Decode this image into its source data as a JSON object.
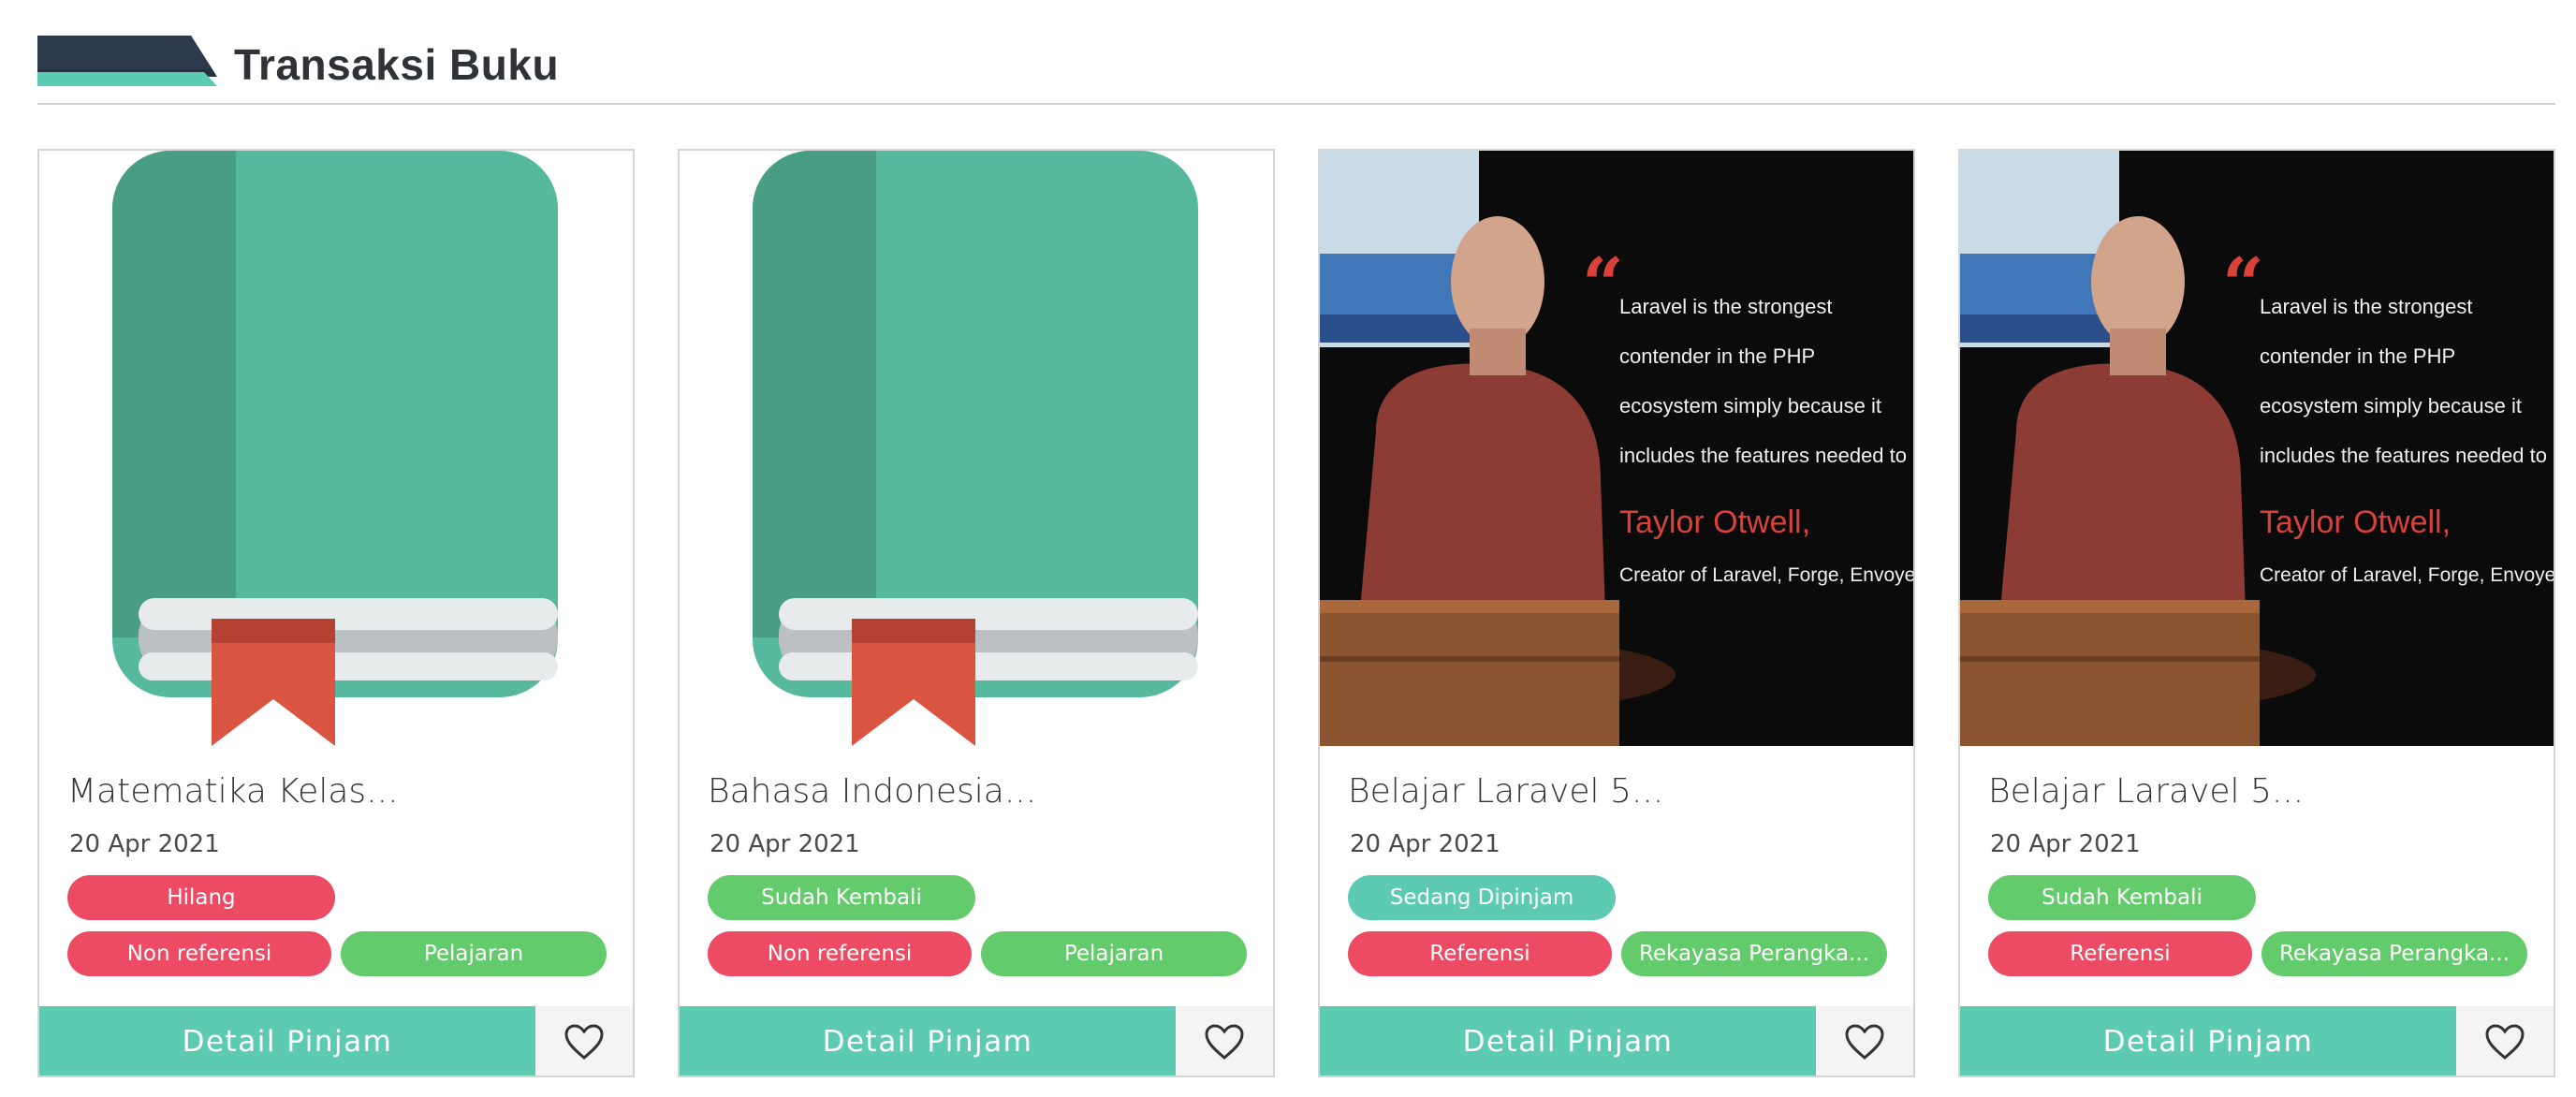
{
  "header": {
    "title": "Transaksi Buku"
  },
  "cards": [
    {
      "image": "green-book-icon",
      "title": "Matematika Kelas...",
      "date": "20 Apr 2021",
      "status": "Hilang",
      "status_color": "#ec4b63",
      "type": "Non referensi",
      "category": "Pelajaran",
      "detail_label": "Detail Pinjam",
      "favorite_icon": "heart-outline-icon"
    },
    {
      "image": "green-book-icon",
      "title": "Bahasa Indonesia...",
      "date": "20 Apr 2021",
      "status": "Sudah Kembali",
      "status_color": "#63cb6b",
      "type": "Non referensi",
      "category": "Pelajaran",
      "detail_label": "Detail Pinjam",
      "favorite_icon": "heart-outline-icon"
    },
    {
      "image": "laravel-quote-photo",
      "quote": "Laravel is the strongest contender in the PHP ecosystem simply because it includes the features needed to build modern web applications.",
      "quote_author": "Taylor Otwell,",
      "quote_author_title": "Creator of Laravel, Forge, Envoyer",
      "title": "Belajar Laravel 5...",
      "date": "20 Apr 2021",
      "status": "Sedang Dipinjam",
      "status_color": "#5ccbb2",
      "type": "Referensi",
      "category": "Rekayasa Perangka...",
      "detail_label": "Detail Pinjam",
      "favorite_icon": "heart-outline-icon"
    },
    {
      "image": "laravel-quote-photo",
      "quote": "Laravel is the strongest contender in the PHP ecosystem simply because it includes the features needed to build modern web applications.",
      "quote_author": "Taylor Otwell,",
      "quote_author_title": "Creator of Laravel, Forge, Envoyer",
      "title": "Belajar Laravel 5...",
      "date": "20 Apr 2021",
      "status": "Sudah Kembali",
      "status_color": "#63cb6b",
      "type": "Referensi",
      "category": "Rekayasa Perangka...",
      "detail_label": "Detail Pinjam",
      "favorite_icon": "heart-outline-icon"
    }
  ],
  "colors": {
    "accent": "#5ccbb2",
    "danger": "#ec4b63",
    "success": "#63cb6b",
    "book_green": "#56b99d"
  }
}
